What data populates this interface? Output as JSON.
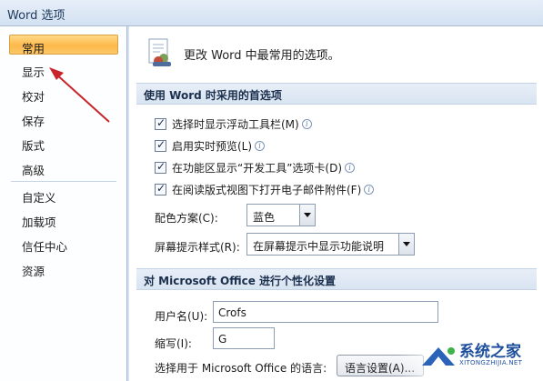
{
  "window": {
    "title": "Word 选项"
  },
  "nav": {
    "items": [
      {
        "label": "常用",
        "active": true
      },
      {
        "label": "显示",
        "active": false
      },
      {
        "label": "校对",
        "active": false
      },
      {
        "label": "保存",
        "active": false
      },
      {
        "label": "版式",
        "active": false
      },
      {
        "label": "高级",
        "active": false
      },
      {
        "label": "自定义",
        "active": false
      },
      {
        "label": "加载项",
        "active": false
      },
      {
        "label": "信任中心",
        "active": false
      },
      {
        "label": "资源",
        "active": false
      }
    ]
  },
  "header": {
    "text": "更改 Word 中最常用的选项。"
  },
  "section1": {
    "title": "使用 Word 时采用的首选项",
    "checkboxes": [
      {
        "label": "选择时显示浮动工具栏(M)",
        "checked": true
      },
      {
        "label": "启用实时预览(L)",
        "checked": true
      },
      {
        "label": "在功能区显示“开发工具”选项卡(D)",
        "checked": true
      },
      {
        "label": "在阅读版式视图下打开电子邮件附件(F)",
        "checked": true
      }
    ],
    "color_scheme": {
      "label": "配色方案(C):",
      "value": "蓝色"
    },
    "tooltip_style": {
      "label": "屏幕提示样式(R):",
      "value": "在屏幕提示中显示功能说明"
    }
  },
  "section2": {
    "title": "对 Microsoft Office 进行个性化设置",
    "username": {
      "label": "用户名(U):",
      "value": "Crofs"
    },
    "initials": {
      "label": "缩写(I):",
      "value": "G"
    },
    "language": {
      "label": "选择用于 Microsoft Office 的语言:",
      "button": "语言设置(A)..."
    }
  },
  "watermark": {
    "text": "系统之家",
    "subtext": "XITONGZHIJIA.NET"
  },
  "colors": {
    "accent_orange": "#fdb84a",
    "annotation_red": "#c8242a",
    "brand_blue": "#1e4f9c"
  }
}
